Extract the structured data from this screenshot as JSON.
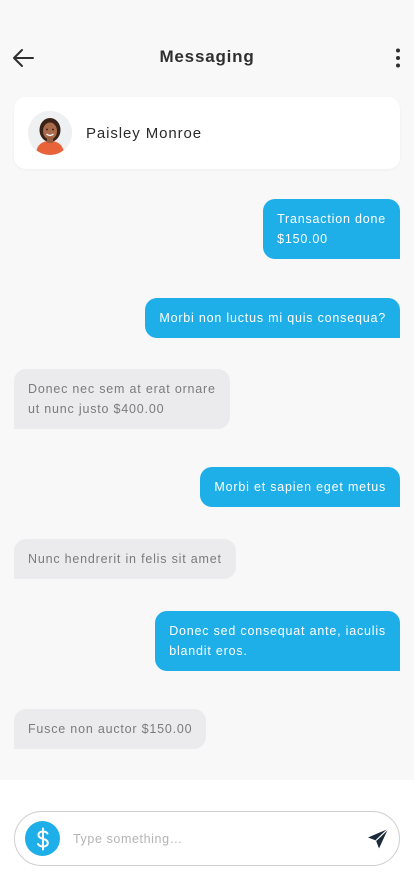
{
  "header": {
    "title": "Messaging",
    "back_icon": "arrow-left-icon",
    "menu_icon": "more-vertical-icon"
  },
  "contact": {
    "name": "Paisley Monroe",
    "avatar_icon": "avatar-photo"
  },
  "messages": [
    {
      "direction": "outgoing",
      "lines": [
        "Transaction done",
        "$150.00"
      ]
    },
    {
      "direction": "outgoing",
      "lines": [
        "Morbi non luctus mi quis consequa?"
      ]
    },
    {
      "direction": "incoming",
      "lines": [
        "Donec nec sem at erat ornare",
        "ut nunc justo $400.00"
      ]
    },
    {
      "direction": "outgoing",
      "lines": [
        "Morbi et sapien eget metus"
      ]
    },
    {
      "direction": "incoming",
      "lines": [
        "Nunc hendrerit in felis sit amet"
      ]
    },
    {
      "direction": "outgoing",
      "lines": [
        "Donec sed consequat ante, iaculis",
        "blandit eros."
      ]
    },
    {
      "direction": "incoming",
      "lines": [
        "Fusce non auctor $150.00"
      ]
    }
  ],
  "composer": {
    "placeholder": "Type something…",
    "value": "",
    "dollar_icon": "dollar-icon",
    "send_icon": "send-icon"
  },
  "colors": {
    "accent": "#1eaee8",
    "incoming_bubble": "#ebebed",
    "background": "#f8f8f8"
  }
}
